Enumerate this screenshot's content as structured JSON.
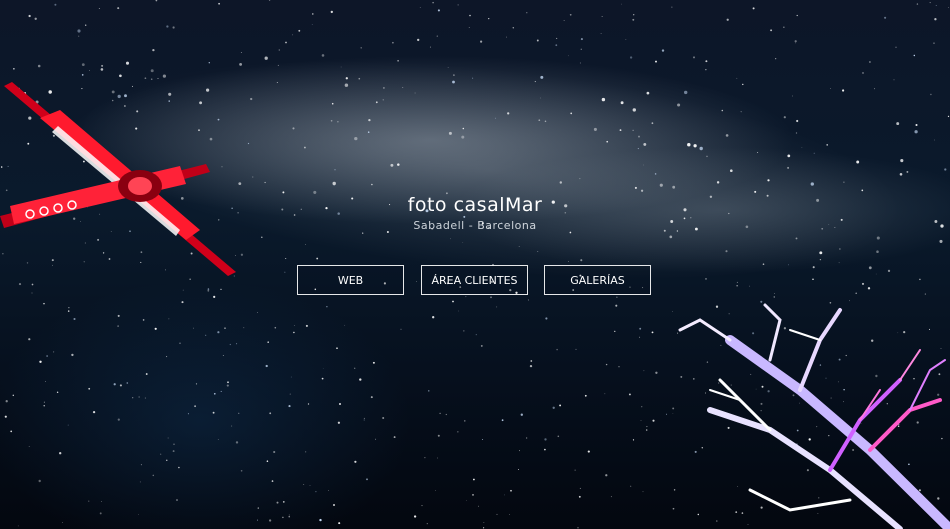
{
  "brand": {
    "title": "foto casalMar",
    "subtitle": "Sabadell - Barcelona"
  },
  "nav": {
    "buttons": [
      {
        "label": "WEB"
      },
      {
        "label": "ÁREA CLIENTES"
      },
      {
        "label": "GALERÍAS"
      }
    ]
  },
  "colors": {
    "text": "#ffffff",
    "button_border": "#ffffff",
    "sky": "#0a1a2c",
    "windmill": "#e0001b"
  },
  "background": {
    "subject": "starry night sky with milky way",
    "icons": [
      "windmill-blades-graphic",
      "tree-silhouette-graphic"
    ]
  }
}
